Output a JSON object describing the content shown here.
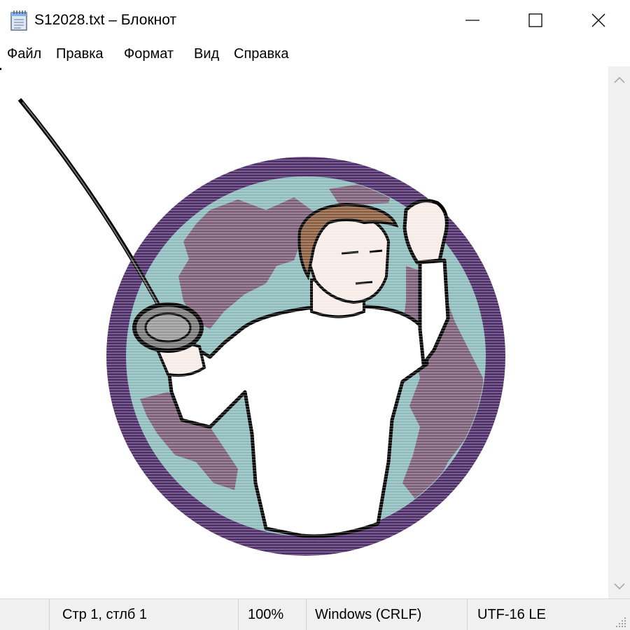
{
  "window": {
    "title": "S12028.txt – Блокнот",
    "app_icon": "notepad-icon",
    "controls": [
      "minimize-icon",
      "maximize-icon",
      "close-icon"
    ]
  },
  "menu": {
    "items": [
      "Файл",
      "Правка",
      "Формат",
      "Вид",
      "Справка"
    ]
  },
  "editor": {
    "content_description_icon": "fencer-ascii-art",
    "colors": {
      "ring": "#4f2f6a",
      "globe_bg": "#8fbcbc",
      "continents": "#7c5f78",
      "jacket": "#ffffff",
      "jacket_shadow": "#a8bcd6",
      "hair": "#8b5e40",
      "skin": "#f6ebe7",
      "outline": "#000000"
    }
  },
  "scrollbar": {
    "up_icon": "scroll-up-arrow-icon",
    "down_icon": "scroll-down-arrow-icon"
  },
  "status": {
    "position": "Стр 1, стлб 1",
    "zoom": "100%",
    "line_endings": "Windows (CRLF)",
    "encoding": "UTF-16 LE"
  }
}
